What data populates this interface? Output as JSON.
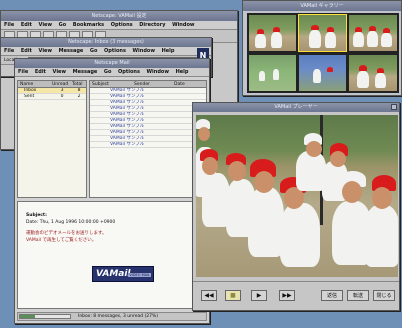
{
  "gallery": {
    "title": "VAMail ギャラリー"
  },
  "browser_back": {
    "title": "Netscape: VAMail 設定",
    "menu": [
      "File",
      "Edit",
      "View",
      "Go",
      "Bookmarks",
      "Options",
      "Directory",
      "Window"
    ]
  },
  "browser_mid": {
    "title": "Netscape: Inbox (3 messages)",
    "menu": [
      "File",
      "Edit",
      "View",
      "Message",
      "Go",
      "Options",
      "Window",
      "Help"
    ],
    "location_label": "Location:",
    "location_value": "mailbox:/usr/local/VAMail/messages/Inbox"
  },
  "mail": {
    "title": "Netscape Mail",
    "menu": [
      "File",
      "Edit",
      "View",
      "Message",
      "Go",
      "Options",
      "Window",
      "Help"
    ],
    "folder_header": [
      "Name",
      "Unread",
      "Total"
    ],
    "folders": [
      {
        "name": "Inbox",
        "unread": "3",
        "total": "8"
      },
      {
        "name": "Sent",
        "unread": "0",
        "total": "2"
      }
    ],
    "msg_header": [
      "Subject",
      "Sender",
      "Date"
    ],
    "messages": [
      "VAMail サンプル",
      "VAMail サンプル",
      "VAMail サンプル",
      "VAMail サンプル",
      "VAMail サンプル",
      "VAMail サンプル",
      "VAMail サンプル",
      "VAMail サンプル",
      "VAMail サンプル",
      "VAMail サンプル"
    ],
    "subject_label": "Subject:",
    "date_line": "Date: Thu, 1 Aug 1996 10:00:00 +0900",
    "body_line1": "運動会のビデオメールをお送りします。",
    "body_line2": "VAMail で再生してご覧ください。",
    "logo_text": "VAMail",
    "logo_sub": "VIDEO MAIL",
    "status_text": "Inbox: 8 messages, 3 unread (27%)"
  },
  "player": {
    "title": "VAMail プレーヤー",
    "buttons": [
      "◀◀",
      "■",
      "▶",
      "▶▶"
    ],
    "right_buttons": [
      "返信",
      "転送",
      "閉じる"
    ]
  },
  "colors": {
    "desktop": "#6f90b6",
    "cap_red": "#d81c1c",
    "logo_bg": "#28336e"
  }
}
